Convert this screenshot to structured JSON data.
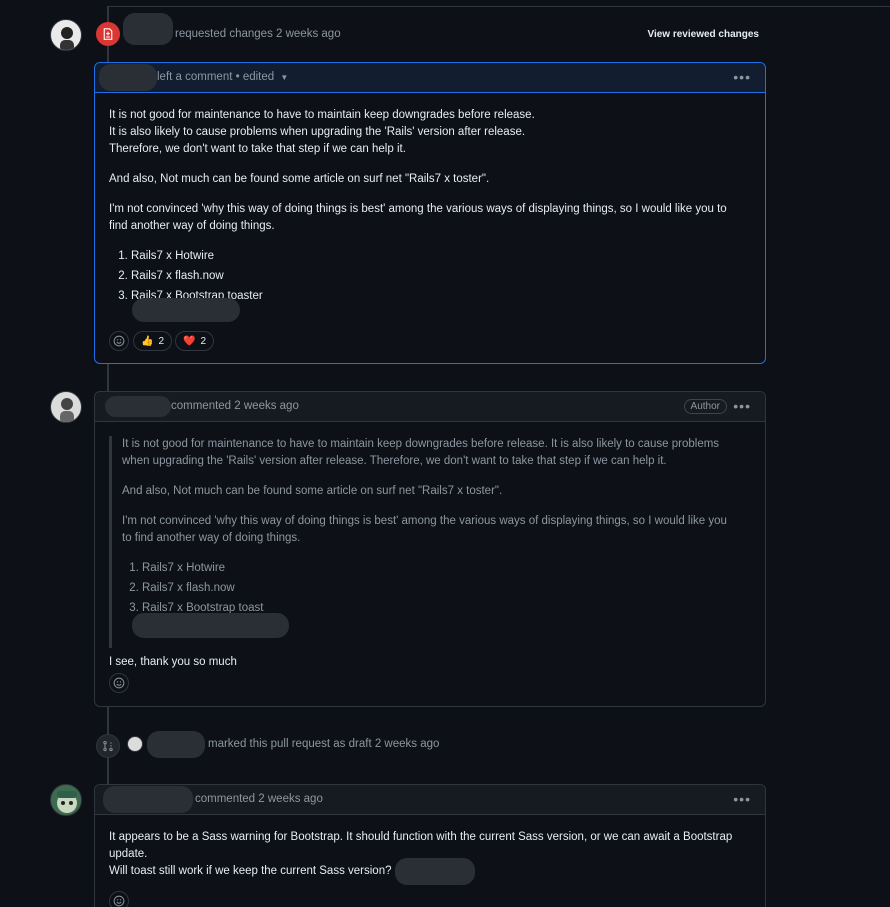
{
  "review": {
    "action_text": "requested changes 2 weeks ago",
    "view_button": "View reviewed changes",
    "comment_meta": "left a comment • edited",
    "paragraphs": [
      "It is not good for maintenance to have to maintain keep downgrades before release.",
      "It is also likely to cause problems when upgrading the 'Rails' version after release.",
      "Therefore, we don't want to take that step if we can help it."
    ],
    "para2": "And also, Not much can be found some article on surf net \"Rails7 x toster\".",
    "para3_line1": "I'm not convinced 'why this way of doing things is best' among the various ways of displaying things, so I would like you to",
    "para3_line2": "find another way of doing things.",
    "list": [
      "Rails7 x Hotwire",
      "Rails7 x flash.now",
      "Rails7 x Bootstrap toaster"
    ],
    "reactions": [
      {
        "emoji": "👍",
        "count": "2"
      },
      {
        "emoji": "❤️",
        "count": "2"
      }
    ]
  },
  "comment2": {
    "meta": "commented 2 weeks ago",
    "badge": "Author",
    "quote_p1_line1": "It is not good for maintenance to have to maintain keep downgrades before release. It is also likely to cause problems",
    "quote_p1_line2": "when upgrading the 'Rails' version after release. Therefore, we don't want to take that step if we can help it.",
    "quote_p2": "And also, Not much can be found some article on surf net \"Rails7 x toster\".",
    "quote_p3_line1": "I'm not convinced 'why this way of doing things is best' among the various ways of displaying things, so I would like you",
    "quote_p3_line2": "to find another way of doing things.",
    "quote_list": [
      "Rails7 x Hotwire",
      "Rails7 x flash.now",
      "Rails7 x Bootstrap toast"
    ],
    "reply": "I see, thank you so much"
  },
  "event": {
    "text": "marked this pull request as draft 2 weeks ago"
  },
  "comment3": {
    "meta": "commented 2 weeks ago",
    "line1": "It appears to be a Sass warning for Bootstrap. It should function with the current Sass version, or we can await a Bootstrap",
    "line2": "update.",
    "line3": "Will toast still work if we keep the current Sass version?"
  },
  "colors": {
    "background": "#0d1117",
    "border": "#30363d",
    "accent_blue": "#1f6feb",
    "changes_red": "#da3633",
    "muted_text": "#8d96a0"
  },
  "icons": {
    "review_state": "file-diff-icon",
    "more": "kebab-horizontal-icon",
    "reaction": "smiley-icon",
    "dropdown": "triangle-down-icon",
    "draft_event": "git-pull-request-draft-icon"
  }
}
